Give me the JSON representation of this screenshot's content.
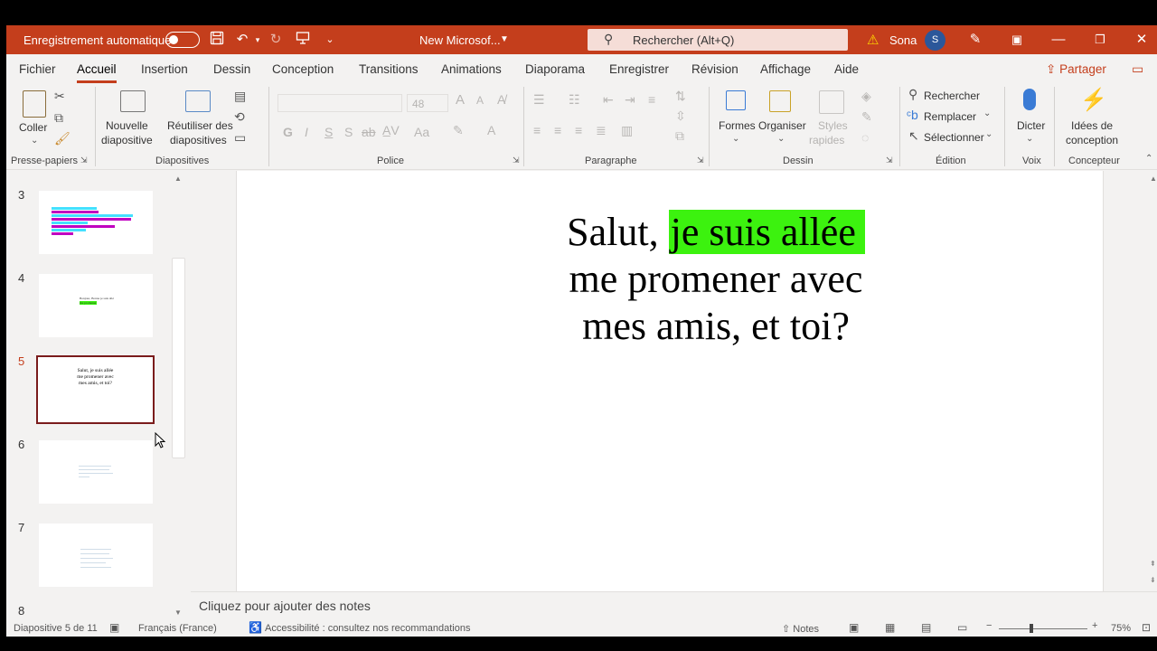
{
  "titlebar": {
    "autosave_label": "Enregistrement automatique",
    "doc_title": "New Microsof...",
    "search_placeholder": "Rechercher (Alt+Q)",
    "user_name": "Sona",
    "user_initial": "S",
    "accent": "#c43e1c"
  },
  "tabs": [
    "Fichier",
    "Accueil",
    "Insertion",
    "Dessin",
    "Conception",
    "Transitions",
    "Animations",
    "Diaporama",
    "Enregistrer",
    "Révision",
    "Affichage",
    "Aide"
  ],
  "active_tab": "Accueil",
  "share_label": "Partager",
  "ribbon": {
    "clipboard": {
      "paste": "Coller",
      "group": "Presse-papiers"
    },
    "slides": {
      "new_slide_1": "Nouvelle",
      "new_slide_2": "diapositive",
      "reuse_1": "Réutiliser des",
      "reuse_2": "diapositives",
      "group": "Diapositives"
    },
    "font": {
      "size": "48",
      "bold": "G",
      "italic": "I",
      "underline": "S",
      "shadow": "S",
      "strike": "ab",
      "group": "Police"
    },
    "paragraph": {
      "group": "Paragraphe"
    },
    "drawing": {
      "shapes": "Formes",
      "arrange": "Organiser",
      "styles_1": "Styles",
      "styles_2": "rapides",
      "group": "Dessin"
    },
    "editing": {
      "find": "Rechercher",
      "replace": "Remplacer",
      "select": "Sélectionner",
      "group": "Édition"
    },
    "voice": {
      "dictate": "Dicter",
      "group": "Voix"
    },
    "designer": {
      "ideas_1": "Idées de",
      "ideas_2": "conception",
      "group": "Concepteur"
    }
  },
  "thumbnails": [
    {
      "num": "3"
    },
    {
      "num": "4",
      "text_line1": "Bonjour, Bonne je suis allé",
      "text_line2": "me promener"
    },
    {
      "num": "5",
      "text_line1": "Salut, je suis allée",
      "text_line2": "me promener avec",
      "text_line3": "mes amis, et toi?"
    },
    {
      "num": "6"
    },
    {
      "num": "7"
    },
    {
      "num": "8"
    }
  ],
  "slide": {
    "text_before": "Salut, ",
    "highlighted": "je suis allée",
    "line2": "me promener avec",
    "line3": "mes amis, et toi?",
    "highlight_color": "#3cf20f"
  },
  "notes_placeholder": "Cliquez pour ajouter des notes",
  "status": {
    "slide_info": "Diapositive 5 de 11",
    "language": "Français (France)",
    "accessibility": "Accessibilité : consultez nos recommandations",
    "notes": "Notes",
    "zoom": "75%"
  }
}
